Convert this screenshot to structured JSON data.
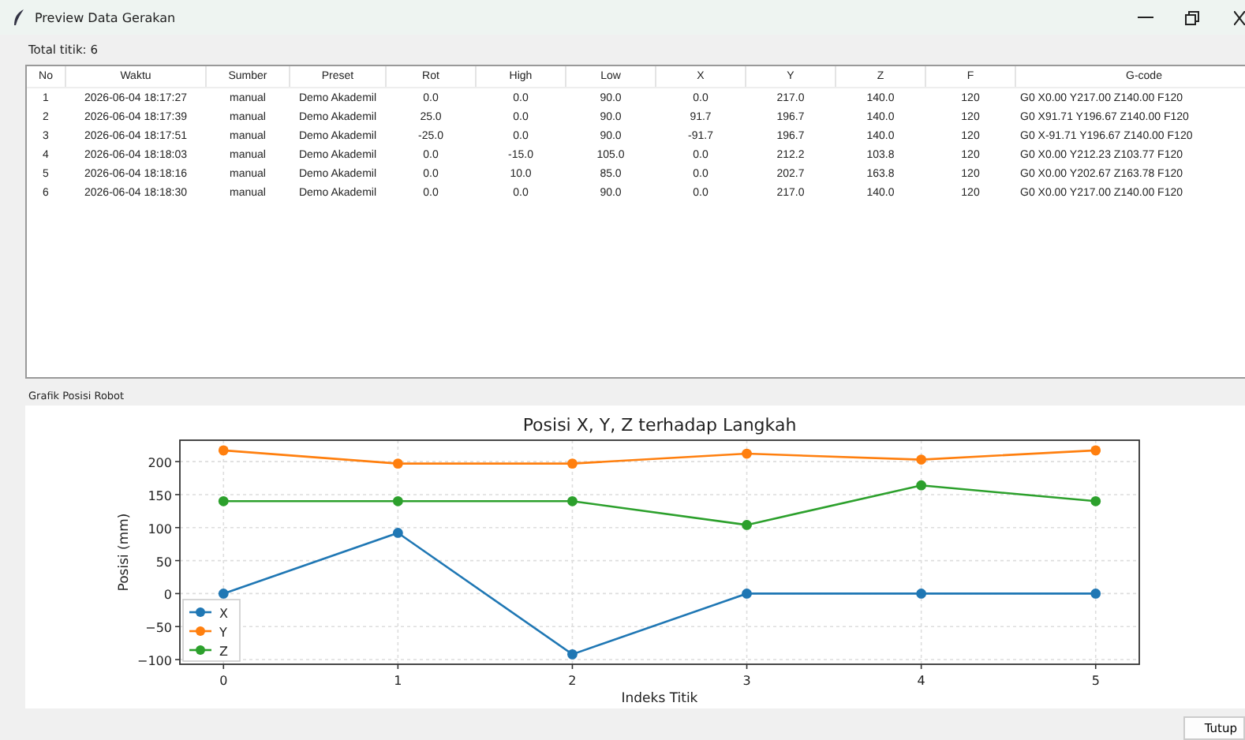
{
  "window": {
    "title": "Preview Data Gerakan"
  },
  "summary": "Total titik: 6",
  "table": {
    "columns": [
      "No",
      "Waktu",
      "Sumber",
      "Preset",
      "Rot",
      "High",
      "Low",
      "X",
      "Y",
      "Z",
      "F",
      "G-code"
    ],
    "rows": [
      [
        "1",
        "2026-06-04 18:17:27",
        "manual",
        "Demo Akademil",
        "0.0",
        "0.0",
        "90.0",
        "0.0",
        "217.0",
        "140.0",
        "120",
        "G0 X0.00 Y217.00 Z140.00 F120"
      ],
      [
        "2",
        "2026-06-04 18:17:39",
        "manual",
        "Demo Akademil",
        "25.0",
        "0.0",
        "90.0",
        "91.7",
        "196.7",
        "140.0",
        "120",
        "G0 X91.71 Y196.67 Z140.00 F120"
      ],
      [
        "3",
        "2026-06-04 18:17:51",
        "manual",
        "Demo Akademil",
        "-25.0",
        "0.0",
        "90.0",
        "-91.7",
        "196.7",
        "140.0",
        "120",
        "G0 X-91.71 Y196.67 Z140.00 F120"
      ],
      [
        "4",
        "2026-06-04 18:18:03",
        "manual",
        "Demo Akademil",
        "0.0",
        "-15.0",
        "105.0",
        "0.0",
        "212.2",
        "103.8",
        "120",
        "G0 X0.00 Y212.23 Z103.77 F120"
      ],
      [
        "5",
        "2026-06-04 18:18:16",
        "manual",
        "Demo Akademil",
        "0.0",
        "10.0",
        "85.0",
        "0.0",
        "202.7",
        "163.8",
        "120",
        "G0 X0.00 Y202.67 Z163.78 F120"
      ],
      [
        "6",
        "2026-06-04 18:18:30",
        "manual",
        "Demo Akademil",
        "0.0",
        "0.0",
        "90.0",
        "0.0",
        "217.0",
        "140.0",
        "120",
        "G0 X0.00 Y217.00 Z140.00 F120"
      ]
    ]
  },
  "chart_section": {
    "label": "Grafik Posisi Robot",
    "chart_data": {
      "type": "line",
      "title": "Posisi X, Y, Z terhadap Langkah",
      "xlabel": "Indeks Titik",
      "ylabel": "Posisi (mm)",
      "x": [
        0,
        1,
        2,
        3,
        4,
        5
      ],
      "series": [
        {
          "name": "X",
          "color": "#1f77b4",
          "marker": "o",
          "values": [
            0,
            92,
            -92,
            0,
            0,
            0
          ]
        },
        {
          "name": "Y",
          "color": "#ff7f0e",
          "marker": "o",
          "values": [
            217,
            197,
            197,
            212,
            203,
            217
          ]
        },
        {
          "name": "Z",
          "color": "#2ca02c",
          "marker": "o",
          "values": [
            140,
            140,
            140,
            104,
            164,
            140
          ]
        }
      ],
      "grid": true,
      "legend": true,
      "xlim": [
        -0.25,
        5.25
      ],
      "ylim": [
        -107.1,
        232.4
      ],
      "xticks": [
        0,
        1,
        2,
        3,
        4,
        5
      ],
      "yticks": [
        {
          "value": -100,
          "label": "−100"
        },
        {
          "value": -50,
          "label": "−50"
        },
        0,
        50,
        100,
        150,
        200
      ]
    }
  },
  "buttons": [
    "Tutup"
  ]
}
